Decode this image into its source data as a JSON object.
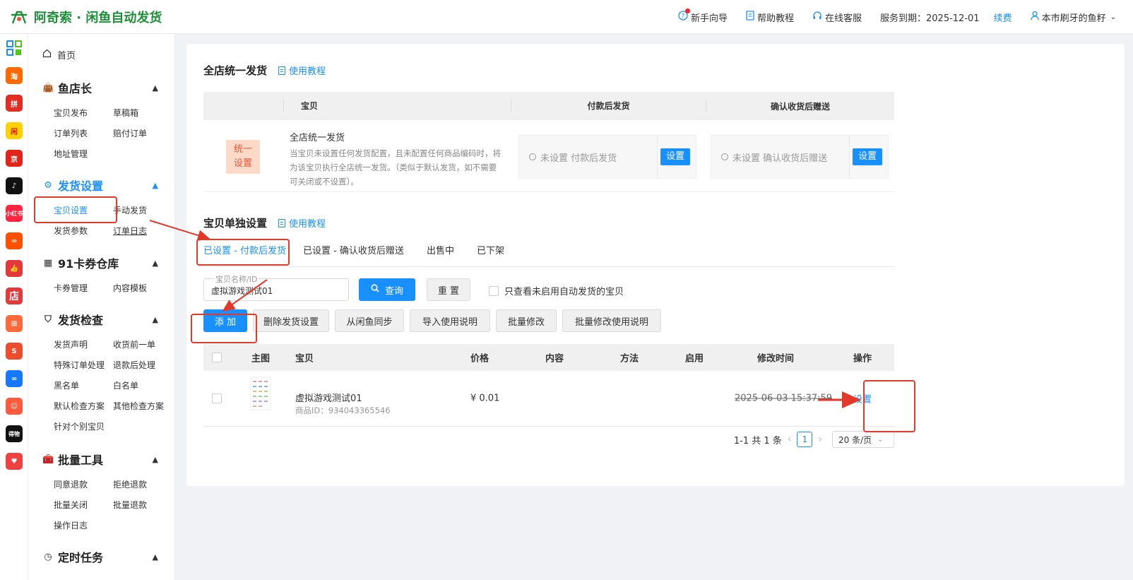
{
  "header": {
    "brand": "阿奇索 · 闲鱼自动发货",
    "nav": [
      {
        "label": "新手向导",
        "icon": "question-circle-icon"
      },
      {
        "label": "帮助教程",
        "icon": "doc-icon"
      },
      {
        "label": "在线客服",
        "icon": "headset-icon"
      }
    ],
    "service_expiry": "服务到期：2025-12-01",
    "renew": "续费",
    "user": "本市刷牙的鱼籽"
  },
  "sidebar": {
    "home": "首页",
    "sections": [
      {
        "title": "鱼店长",
        "icon": "bag-icon",
        "items": [
          "宝贝发布",
          "草稿箱",
          "订单列表",
          "赔付订单",
          "地址管理"
        ]
      },
      {
        "title": "发货设置",
        "icon": "gear-icon",
        "items": [
          "宝贝设置",
          "手动发货",
          "发货参数",
          "订单日志"
        ]
      },
      {
        "title": "91卡券仓库",
        "icon": "grid-icon",
        "items": [
          "卡券管理",
          "内容模板"
        ]
      },
      {
        "title": "发货检查",
        "icon": "shield-icon",
        "items": [
          "发货声明",
          "收货前一单",
          "特殊订单处理",
          "退款后处理",
          "黑名单",
          "白名单",
          "默认检查方案",
          "其他检查方案",
          "针对个别宝贝"
        ]
      },
      {
        "title": "批量工具",
        "icon": "toolbox-icon",
        "items": [
          "同意退款",
          "拒绝退款",
          "批量关闭",
          "批量退款",
          "操作日志"
        ]
      },
      {
        "title": "定时任务",
        "icon": "clock-icon",
        "items": []
      }
    ]
  },
  "unified": {
    "title": "全店统一发货",
    "tutorial": "使用教程",
    "columns": [
      "宝贝",
      "付款后发货",
      "确认收货后赠送"
    ],
    "badge": [
      "统一",
      "设置"
    ],
    "row_title": "全店统一发货",
    "row_desc": "当宝贝未设置任何发货配置，且未配置任何商品编码时，将为该宝贝执行全店统一发货。（类似于默认发货，如不需要可关闭或不设置）。",
    "pay_label": "未设置 付款后发货",
    "confirm_label": "未设置 确认收货后赠送",
    "set_btn": "设置"
  },
  "single": {
    "title": "宝贝单独设置",
    "tutorial": "使用教程",
    "tabs": [
      "已设置 - 付款后发货",
      "已设置 - 确认收货后赠送",
      "出售中",
      "已下架"
    ],
    "search": {
      "label": "宝贝名称/ID",
      "value": "虚拟游戏测试01"
    },
    "query_btn": "查询",
    "reset_btn": "重 置",
    "only_label": "只查看未启用自动发货的宝贝",
    "actions": [
      "添 加",
      "删除发货设置",
      "从闲鱼同步",
      "导入使用说明",
      "批量修改",
      "批量修改使用说明"
    ],
    "columns": [
      "主图",
      "宝贝",
      "价格",
      "内容",
      "方法",
      "启用",
      "修改时间",
      "操作"
    ],
    "rows": [
      {
        "name": "虚拟游戏测试01",
        "product_id": "商品ID：934043365546",
        "price": "¥ 0.01",
        "modified": "2025-06-03 15:37:59",
        "action": "设置"
      }
    ],
    "pager": {
      "summary": "1-1 共 1 条",
      "page": "1",
      "size": "20 条/页"
    }
  },
  "colors": {
    "primary": "#1890ff",
    "brand": "#1f8f3a",
    "annotation": "#e23a2a"
  }
}
